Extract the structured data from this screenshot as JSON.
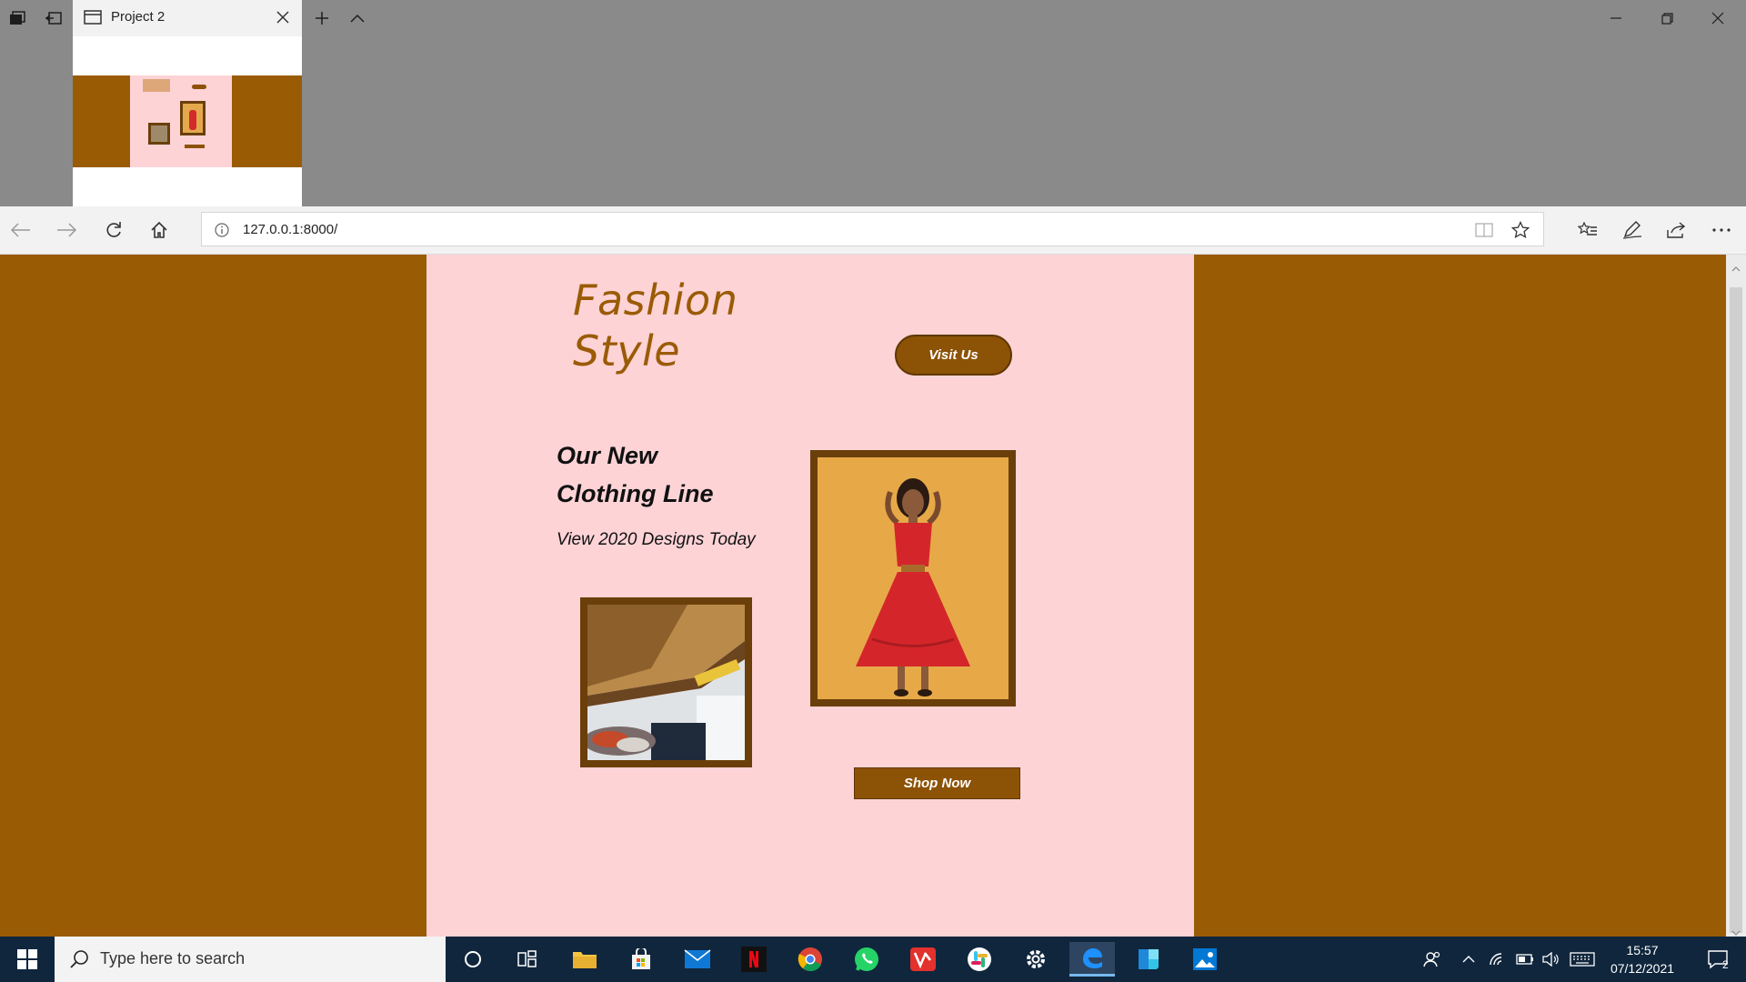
{
  "browser": {
    "tab_title": "Project 2",
    "url": "127.0.0.1:8000/"
  },
  "page": {
    "brand_line1": "Fashion",
    "brand_line2": "Style",
    "visit_button": "Visit Us",
    "headline_line1": "Our New",
    "headline_line2": "Clothing Line",
    "subline": "View 2020 Designs Today",
    "shop_button": "Shop Now"
  },
  "taskbar": {
    "search_placeholder": "Type here to search",
    "time": "15:57",
    "date": "07/12/2021",
    "notification_count": "2"
  },
  "colors": {
    "page_bg": "#9a5b05",
    "card_bg": "#fdd3d6",
    "accent": "#8c5206",
    "frame": "#6b3f0a"
  }
}
